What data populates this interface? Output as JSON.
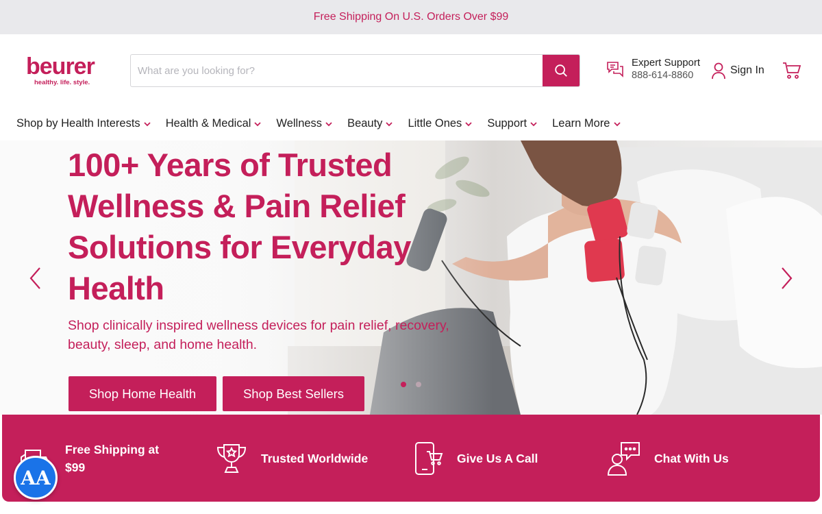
{
  "announcement": {
    "text": "Free Shipping On U.S. Orders Over $99"
  },
  "brand": {
    "name": "beurer",
    "tagline": "healthy. life. style."
  },
  "search": {
    "placeholder": "What are you looking for?",
    "value": ""
  },
  "header": {
    "support_title": "Expert Support",
    "support_phone": "888-614-8860",
    "signin_label": "Sign In"
  },
  "nav": {
    "items": [
      {
        "label": "Shop by Health Interests"
      },
      {
        "label": "Health & Medical"
      },
      {
        "label": "Wellness"
      },
      {
        "label": "Beauty"
      },
      {
        "label": "Little Ones"
      },
      {
        "label": "Support"
      },
      {
        "label": "Learn More"
      }
    ]
  },
  "hero": {
    "title": "100+ Years of Trusted Wellness & Pain Relief Solutions for Everyday Health",
    "subtitle": "Shop clinically inspired wellness devices for pain relief, recovery, beauty, sleep, and home health.",
    "button1": "Shop Home Health",
    "button2": "Shop Best Sellers",
    "slide_count": 2,
    "active_slide": 1
  },
  "features": [
    {
      "label": "Free Shipping at $99",
      "icon": "shipping-box-icon"
    },
    {
      "label": "Trusted Worldwide",
      "icon": "trophy-icon"
    },
    {
      "label": "Give Us A Call",
      "icon": "phone-cart-icon"
    },
    {
      "label": "Chat With Us",
      "icon": "chat-person-icon"
    }
  ],
  "accessibility": {
    "label": "AA"
  },
  "colors": {
    "brand": "#c41f5a",
    "announce_bg": "#e9e9ec",
    "a11y_blue": "#1a73e8"
  }
}
